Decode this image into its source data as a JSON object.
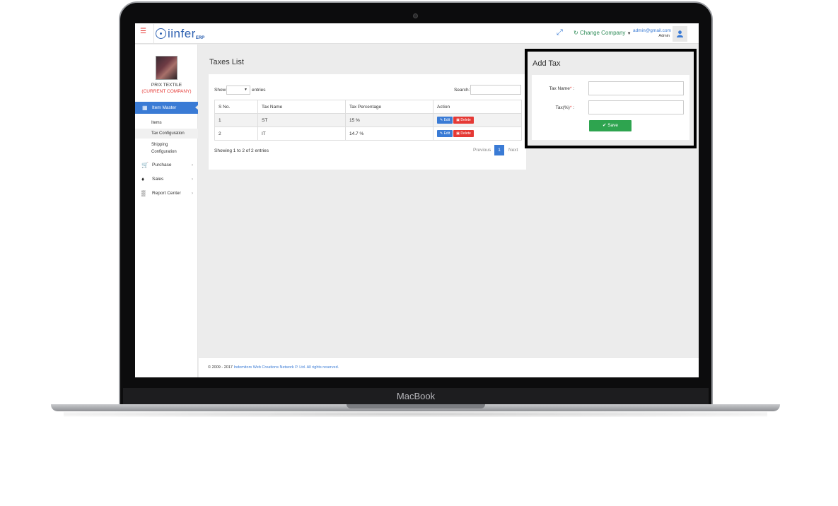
{
  "device": {
    "label": "MacBook"
  },
  "topbar": {
    "logo_text": "iinfer",
    "logo_sub": "ERP",
    "change_company": "Change Company",
    "user_email": "admin@gmail.com",
    "user_role": "Admin"
  },
  "sidebar": {
    "company_name": "PRIX TEXTILE",
    "company_tag": "(CURRENT COMPANY)",
    "active_item": "Item Master",
    "sub_items": [
      "Items",
      "Tax Configuration",
      "Shipping",
      "Configuration"
    ],
    "items": [
      {
        "label": "Purchase",
        "icon": "cart-icon"
      },
      {
        "label": "Sales",
        "icon": "tags-icon"
      },
      {
        "label": "Report Center",
        "icon": "bar-chart-icon"
      }
    ]
  },
  "taxes_list": {
    "title": "Taxes List",
    "show_label": "Show",
    "entries_label": "entries",
    "search_label": "Search:",
    "columns": [
      "S No.",
      "Tax Name",
      "Tax Percentage",
      "Action"
    ],
    "rows": [
      {
        "sno": "1",
        "name": "ST",
        "percentage": "15 %"
      },
      {
        "sno": "2",
        "name": "IT",
        "percentage": "14.7 %"
      }
    ],
    "edit_label": "Edit",
    "delete_label": "Delete",
    "showing_text": "Showing 1 to 2 of 2 entries",
    "prev_label": "Previous",
    "page": "1",
    "next_label": "Next"
  },
  "add_tax": {
    "title": "Add Tax",
    "tax_name_label": "Tax Name",
    "tax_percent_label": "Tax(%)",
    "required_mark": "*",
    "colon": ":",
    "save_label": "Save"
  },
  "footer": {
    "copyright": "© 2009 - 2017",
    "company_link": "Indomitors Web Creations Network P. Ltd. All rights reserved."
  },
  "colors": {
    "primary": "#3a7bd5",
    "danger": "#e53935",
    "success": "#2ea44f"
  }
}
